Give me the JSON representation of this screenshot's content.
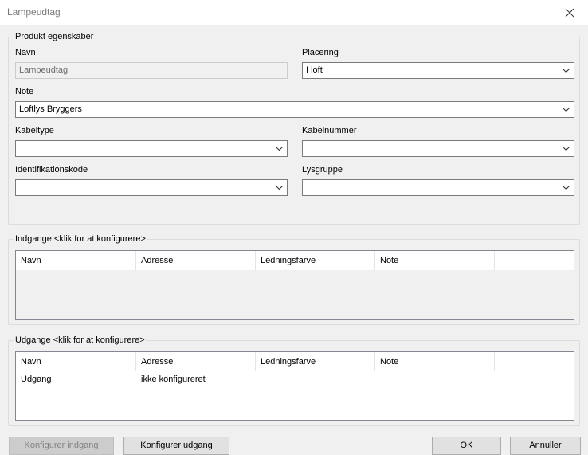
{
  "window": {
    "title": "Lampeudtag"
  },
  "product": {
    "legend": "Produkt egenskaber",
    "name_label": "Navn",
    "name_value": "Lampeudtag",
    "placement_label": "Placering",
    "placement_value": "I loft",
    "note_label": "Note",
    "note_value": "Loftlys Bryggers",
    "cable_type_label": "Kabeltype",
    "cable_type_value": "",
    "cable_number_label": "Kabelnummer",
    "cable_number_value": "",
    "id_code_label": "Identifikationskode",
    "id_code_value": "",
    "light_group_label": "Lysgruppe",
    "light_group_value": ""
  },
  "inputs": {
    "legend": "Indgange <klik for at konfigurere>",
    "columns": [
      "Navn",
      "Adresse",
      "Ledningsfarve",
      "Note"
    ],
    "rows": []
  },
  "outputs": {
    "legend": "Udgange <klik for at konfigurere>",
    "columns": [
      "Navn",
      "Adresse",
      "Ledningsfarve",
      "Note"
    ],
    "rows": [
      {
        "name": "Udgang",
        "address": "ikke konfigureret",
        "wire_color": "",
        "note": ""
      }
    ]
  },
  "buttons": {
    "configure_input": "Konfigurer indgang",
    "configure_output": "Konfigurer udgang",
    "ok": "OK",
    "cancel": "Annuller"
  }
}
